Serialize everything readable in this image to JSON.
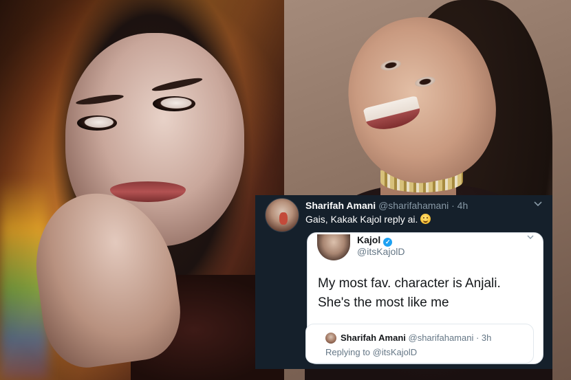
{
  "tweet": {
    "author_name": "Sharifah Amani",
    "author_handle": "@sharifahamani",
    "time_sep": " · ",
    "time": "4h",
    "text": "Gais, Kakak Kajol reply ai.",
    "emoji": "smiling-face-emoji",
    "menu_icon": "chevron-down-icon"
  },
  "quoted_tweet": {
    "author_name": "Kajol",
    "author_handle": "@itsKajolD",
    "verified_icon": "verified-badge-icon",
    "text_line1": "My most fav. character is Anjali.",
    "text_line2": "She's the most like me",
    "menu_icon": "chevron-down-icon"
  },
  "inner_quote": {
    "author_name": "Sharifah Amani",
    "author_handle": "@sharifahamani",
    "time_sep": " · ",
    "time": "3h",
    "replying_to": "Replying to @itsKajolD"
  },
  "colors": {
    "tweet_bg": "#15202b",
    "handle_gray": "#8899a6",
    "verified_blue": "#1da1f2"
  }
}
